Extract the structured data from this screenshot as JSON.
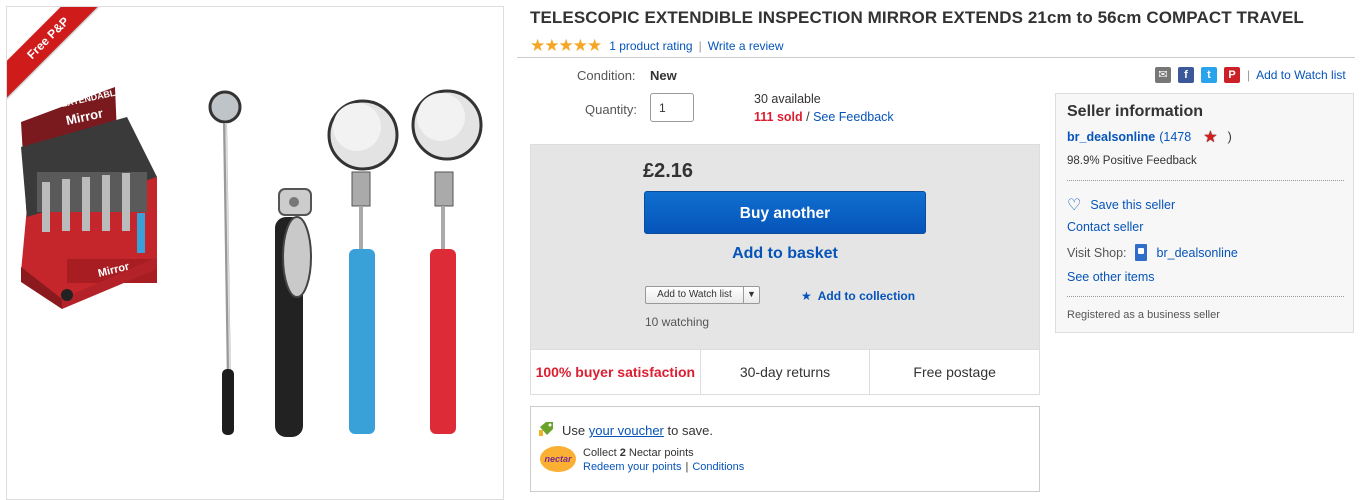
{
  "image_panel": {
    "ribbon": "Free P&P",
    "box_texts": [
      "EXTENDABLE",
      "Mirror"
    ]
  },
  "listing": {
    "title": "TELESCOPIC EXTENDIBLE INSPECTION MIRROR EXTENDS 21cm to 56cm COMPACT TRAVEL",
    "stars": "★★★★★",
    "rating_count": "1 product rating",
    "write_review": "Write a review"
  },
  "condition": {
    "label": "Condition:",
    "value": "New"
  },
  "quantity": {
    "label": "Quantity:",
    "value": "1",
    "available": "30 available",
    "sold": "111 sold",
    "separator": " / ",
    "feedback_link": "See Feedback"
  },
  "buy_box": {
    "price": "£2.16",
    "buy_button": "Buy another",
    "basket_button": "Add to basket",
    "watch_dropdown": "Add to Watch list",
    "collection": "Add to collection",
    "watching": "10 watching"
  },
  "badges": [
    "100% buyer satisfaction",
    "30-day returns",
    "Free postage"
  ],
  "voucher": {
    "prefix": "Use ",
    "link": "your voucher",
    "suffix": " to save.",
    "nectar_logo": "nectar",
    "collect_prefix": "Collect ",
    "collect_points": "2",
    "collect_suffix": " Nectar points",
    "redeem": "Redeem your points",
    "conditions": "Conditions"
  },
  "share": {
    "watch_list": "Add to Watch list"
  },
  "seller": {
    "title": "Seller information",
    "name": "br_dealsonline",
    "score_open": "(1478",
    "score_close": ")",
    "feedback": "98.9% Positive Feedback",
    "save": "Save this seller",
    "contact": "Contact seller",
    "visit_label": "Visit Shop:",
    "shop_name": "br_dealsonline",
    "other_items": "See other items",
    "registered": "Registered as a business seller"
  },
  "colors": {
    "link": "#0654ba",
    "sold_red": "#dd1e31",
    "star": "#f5a623",
    "ribbon": "#d01b1b"
  }
}
